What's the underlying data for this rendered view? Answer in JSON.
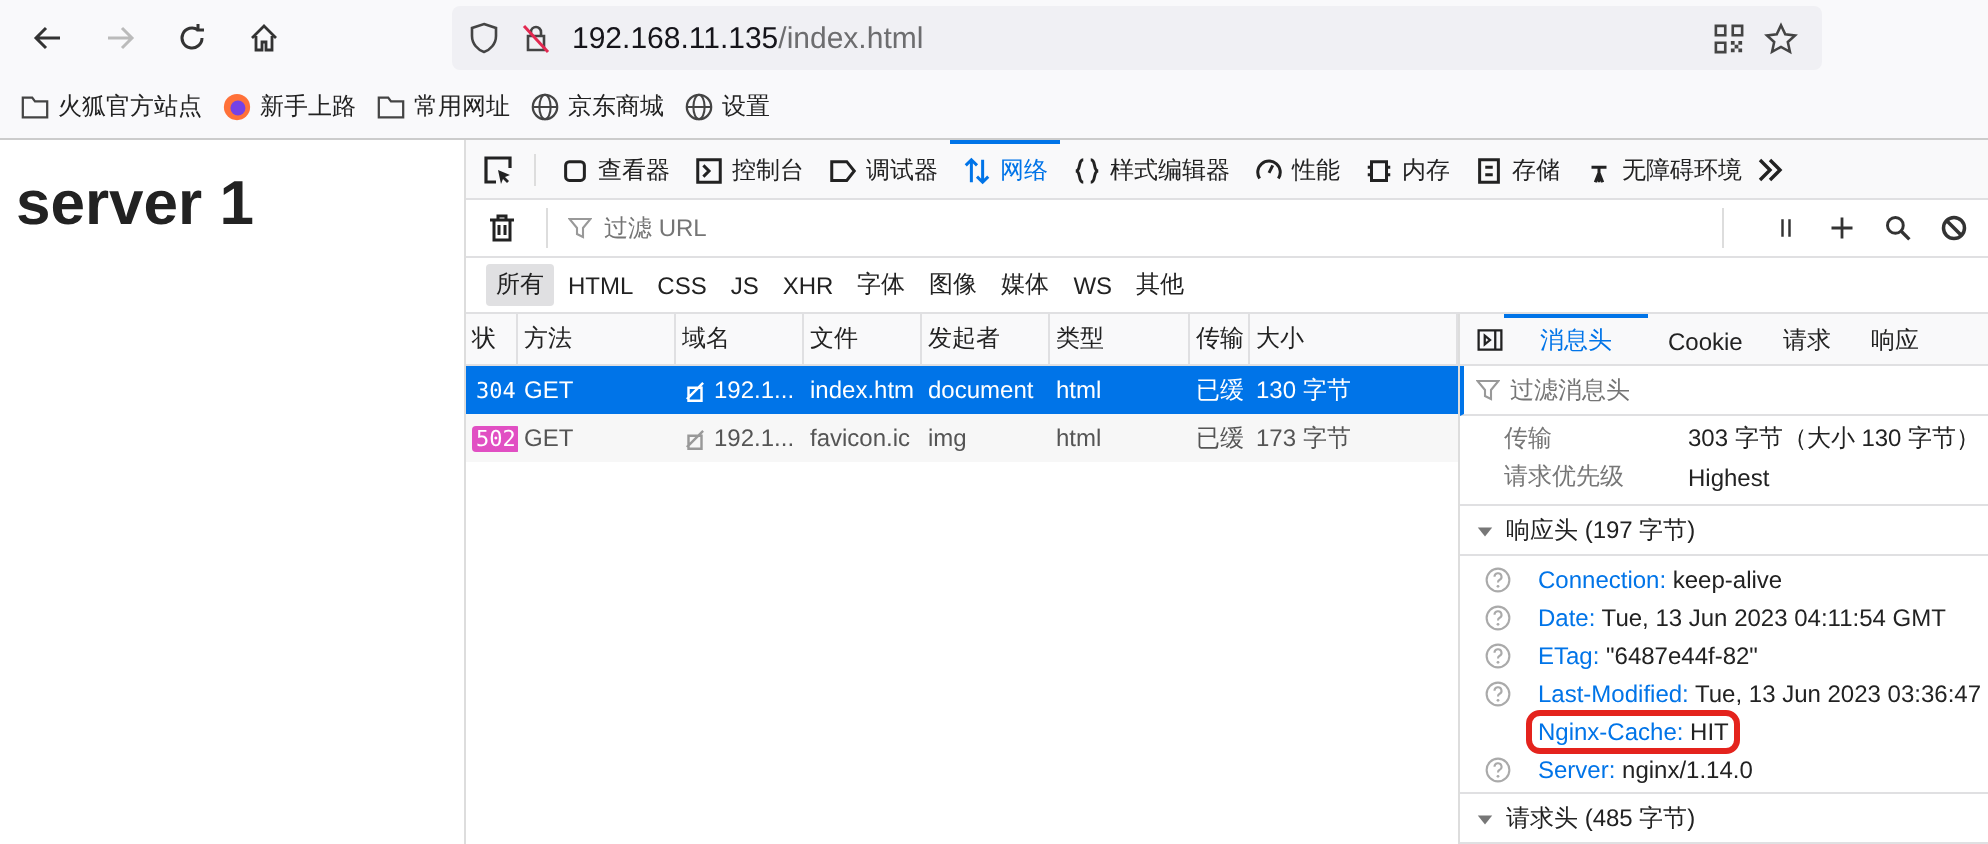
{
  "browser": {
    "forward_disabled": true,
    "url_host": "192.168.11.135",
    "url_path": "/index.html",
    "bookmarks": [
      {
        "label": "火狐官方站点",
        "kind": "folder"
      },
      {
        "label": "新手上路",
        "kind": "firefox"
      },
      {
        "label": "常用网址",
        "kind": "folder"
      },
      {
        "label": "京东商城",
        "kind": "globe"
      },
      {
        "label": "设置",
        "kind": "globe"
      }
    ]
  },
  "page": {
    "heading": "server 1"
  },
  "devtools": {
    "tabs": [
      {
        "label": "查看器",
        "selected": false
      },
      {
        "label": "控制台",
        "selected": false
      },
      {
        "label": "调试器",
        "selected": false
      },
      {
        "label": "网络",
        "selected": true
      },
      {
        "label": "样式编辑器",
        "selected": false
      },
      {
        "label": "性能",
        "selected": false
      },
      {
        "label": "内存",
        "selected": false
      },
      {
        "label": "存储",
        "selected": false
      },
      {
        "label": "无障碍环境",
        "selected": false
      }
    ],
    "filter_placeholder": "过滤 URL",
    "types": [
      {
        "label": "所有",
        "selected": true
      },
      {
        "label": "HTML",
        "selected": false
      },
      {
        "label": "CSS",
        "selected": false
      },
      {
        "label": "JS",
        "selected": false
      },
      {
        "label": "XHR",
        "selected": false
      },
      {
        "label": "字体",
        "selected": false
      },
      {
        "label": "图像",
        "selected": false
      },
      {
        "label": "媒体",
        "selected": false
      },
      {
        "label": "WS",
        "selected": false
      },
      {
        "label": "其他",
        "selected": false
      }
    ],
    "table": {
      "columns": [
        "状",
        "方法",
        "域名",
        "文件",
        "发起者",
        "类型",
        "传输",
        "大小"
      ],
      "rows": [
        {
          "selected": true,
          "status": "304",
          "method": "GET",
          "domain": "192.1...",
          "file": "index.htm",
          "initiator": "document",
          "type": "html",
          "transfer": "已缓",
          "size": "130 字节"
        },
        {
          "selected": false,
          "status": "502",
          "color": "#e14fc3",
          "method": "GET",
          "domain": "192.1...",
          "file": "favicon.ic",
          "initiator": "img",
          "type": "html",
          "transfer": "已缓",
          "size": "173 字节"
        }
      ]
    },
    "details": {
      "tabs": [
        {
          "label": "消息头",
          "selected": true
        },
        {
          "label": "Cookie",
          "selected": false
        },
        {
          "label": "请求",
          "selected": false
        },
        {
          "label": "响应",
          "selected": false
        }
      ],
      "filter_placeholder": "过滤消息头",
      "info": [
        {
          "name": "传输",
          "value": "303 字节（大小 130 字节）"
        },
        {
          "name": "请求优先级",
          "value": "Highest"
        }
      ],
      "sections": [
        {
          "title": "响应头 (197 字节)",
          "expanded": true,
          "headers": [
            {
              "name": "Connection:",
              "value": "keep-alive",
              "highlighted": false
            },
            {
              "name": "Date:",
              "value": "Tue, 13 Jun 2023 04:11:54 GMT",
              "highlighted": false
            },
            {
              "name": "ETag:",
              "value": "\"6487e44f-82\"",
              "highlighted": false
            },
            {
              "name": "Last-Modified:",
              "value": "Tue, 13 Jun 2023 03:36:47",
              "highlighted": false
            },
            {
              "name": "Nginx-Cache:",
              "value": "HIT",
              "highlighted": true
            },
            {
              "name": "Server:",
              "value": "nginx/1.14.0",
              "highlighted": false
            }
          ]
        },
        {
          "title": "请求头 (485 字节)",
          "expanded": true
        }
      ]
    }
  }
}
